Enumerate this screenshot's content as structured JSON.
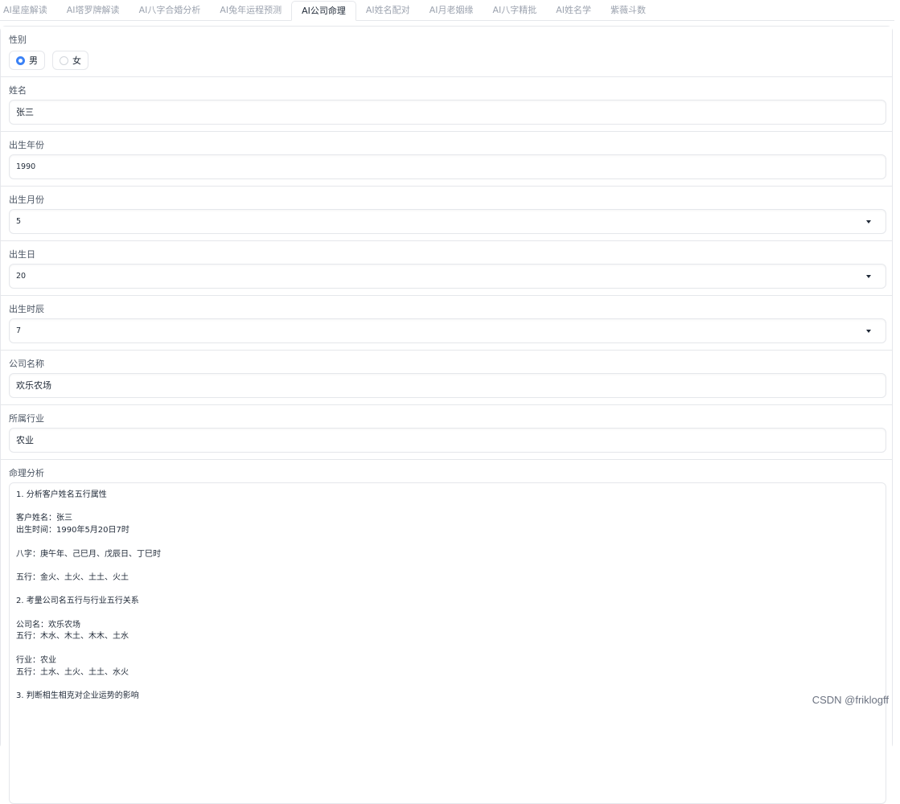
{
  "tabs": [
    {
      "label": "AI星座解读",
      "active": false
    },
    {
      "label": "AI塔罗牌解读",
      "active": false
    },
    {
      "label": "AI八字合婚分析",
      "active": false
    },
    {
      "label": "AI兔年运程预测",
      "active": false
    },
    {
      "label": "AI公司命理",
      "active": true
    },
    {
      "label": "AI姓名配对",
      "active": false
    },
    {
      "label": "AI月老姻缘",
      "active": false
    },
    {
      "label": "AI八字精批",
      "active": false
    },
    {
      "label": "AI姓名学",
      "active": false
    },
    {
      "label": "紫薇斗数",
      "active": false
    }
  ],
  "gender": {
    "label": "性别",
    "options": [
      {
        "label": "男",
        "selected": true
      },
      {
        "label": "女",
        "selected": false
      }
    ]
  },
  "name": {
    "label": "姓名",
    "value": "张三"
  },
  "birth_year": {
    "label": "出生年份",
    "value": "1990"
  },
  "birth_month": {
    "label": "出生月份",
    "value": "5"
  },
  "birth_day": {
    "label": "出生日",
    "value": "20"
  },
  "birth_hour": {
    "label": "出生时辰",
    "value": "7"
  },
  "company_name": {
    "label": "公司名称",
    "value": "欢乐农场"
  },
  "industry": {
    "label": "所属行业",
    "value": "农业"
  },
  "analysis": {
    "label": "命理分析",
    "value": "1. 分析客户姓名五行属性\n\n客户姓名：张三\n出生时间：1990年5月20日7时\n\n八字：庚午年、己巳月、戊辰日、丁巳时\n\n五行：金火、土火、土土、火土\n\n2. 考量公司名五行与行业五行关系\n\n公司名：欢乐农场\n五行：木水、木土、木木、土水\n\n行业：农业\n五行：土水、土火、土土、水火\n\n3. 判断相生相克对企业运势的影响"
  },
  "watermark": "CSDN @friklogff",
  "colors": {
    "accent": "#3b82f6",
    "border": "#e5e7eb"
  }
}
